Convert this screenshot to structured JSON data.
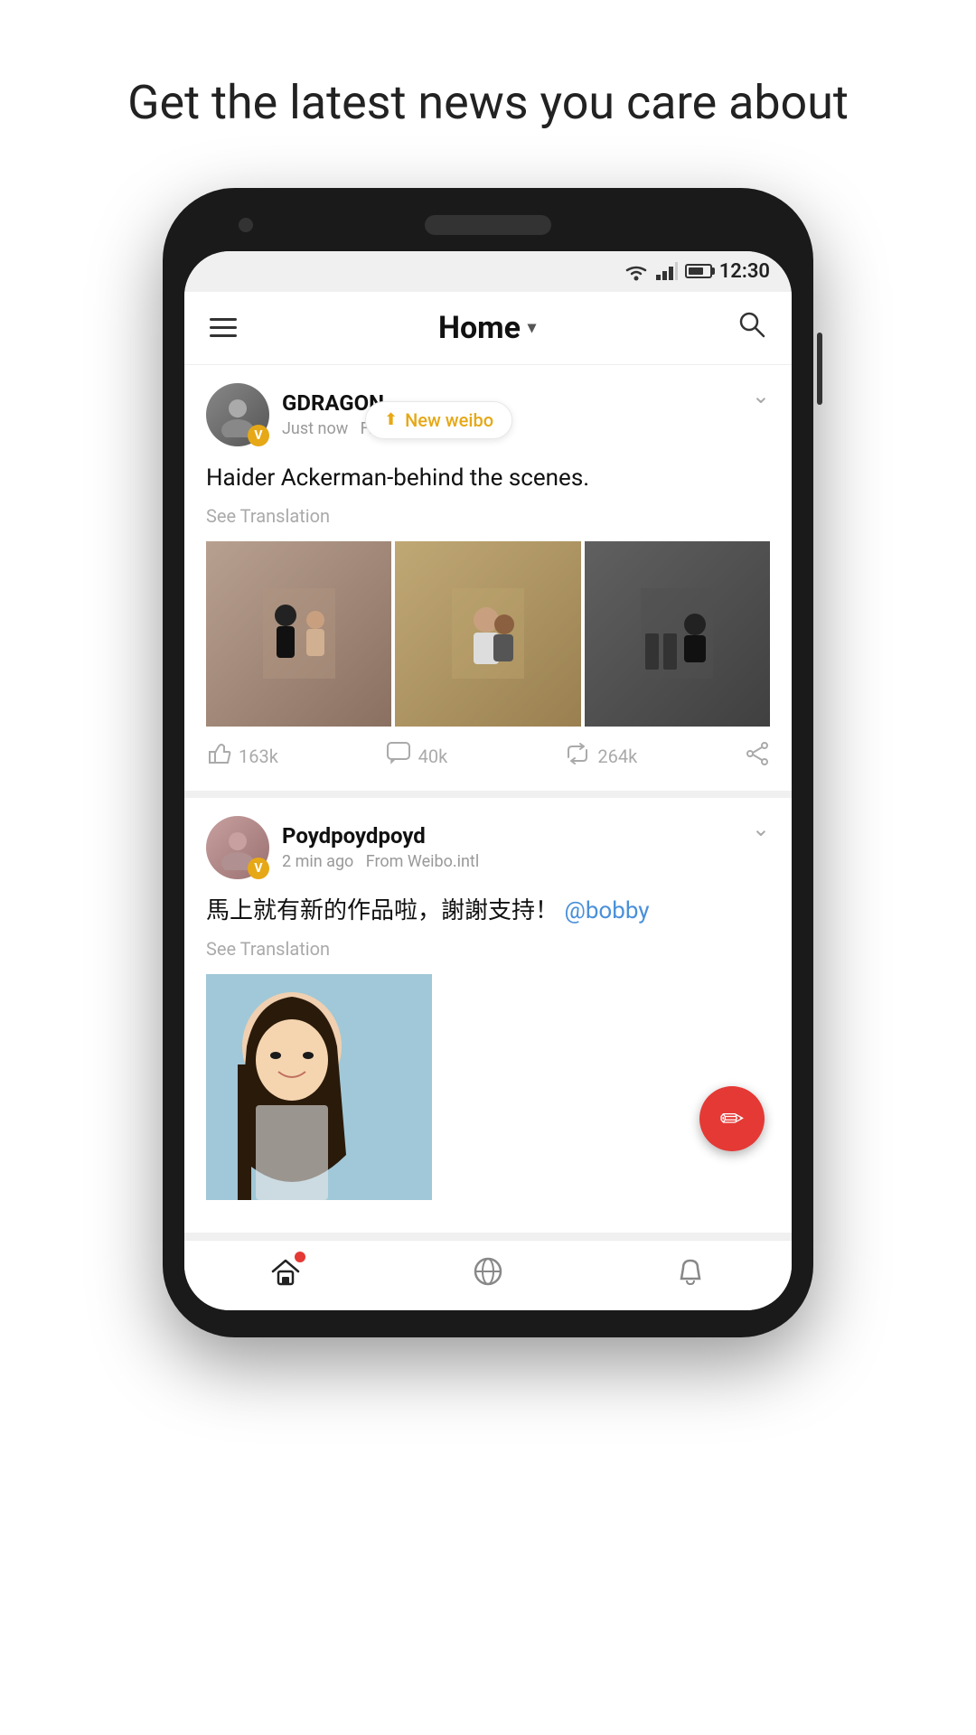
{
  "page": {
    "headline": "Get the latest news you care about"
  },
  "status_bar": {
    "time": "12:30"
  },
  "header": {
    "title": "Home",
    "menu_label": "Menu",
    "search_label": "Search"
  },
  "new_weibo": {
    "label": "New weibo"
  },
  "post1": {
    "author": "GDRAGON",
    "verified": "V",
    "time": "Just now",
    "source": "Fr...",
    "content": "Haider Ackerman-behind the scenes.",
    "see_translation": "See Translation",
    "likes": "163k",
    "comments": "40k",
    "reposts": "264k"
  },
  "post2": {
    "author": "Poydpoydpoyd",
    "verified": "V",
    "time": "2 min ago",
    "source": "From Weibo.intl",
    "content": "馬上就有新的作品啦，謝謝支持！",
    "mention": "@bobby",
    "see_translation": "See Translation"
  },
  "nav": {
    "home": "Home",
    "discover": "Discover",
    "notifications": "Notifications"
  },
  "fab": {
    "icon": "✏",
    "label": "Compose"
  }
}
